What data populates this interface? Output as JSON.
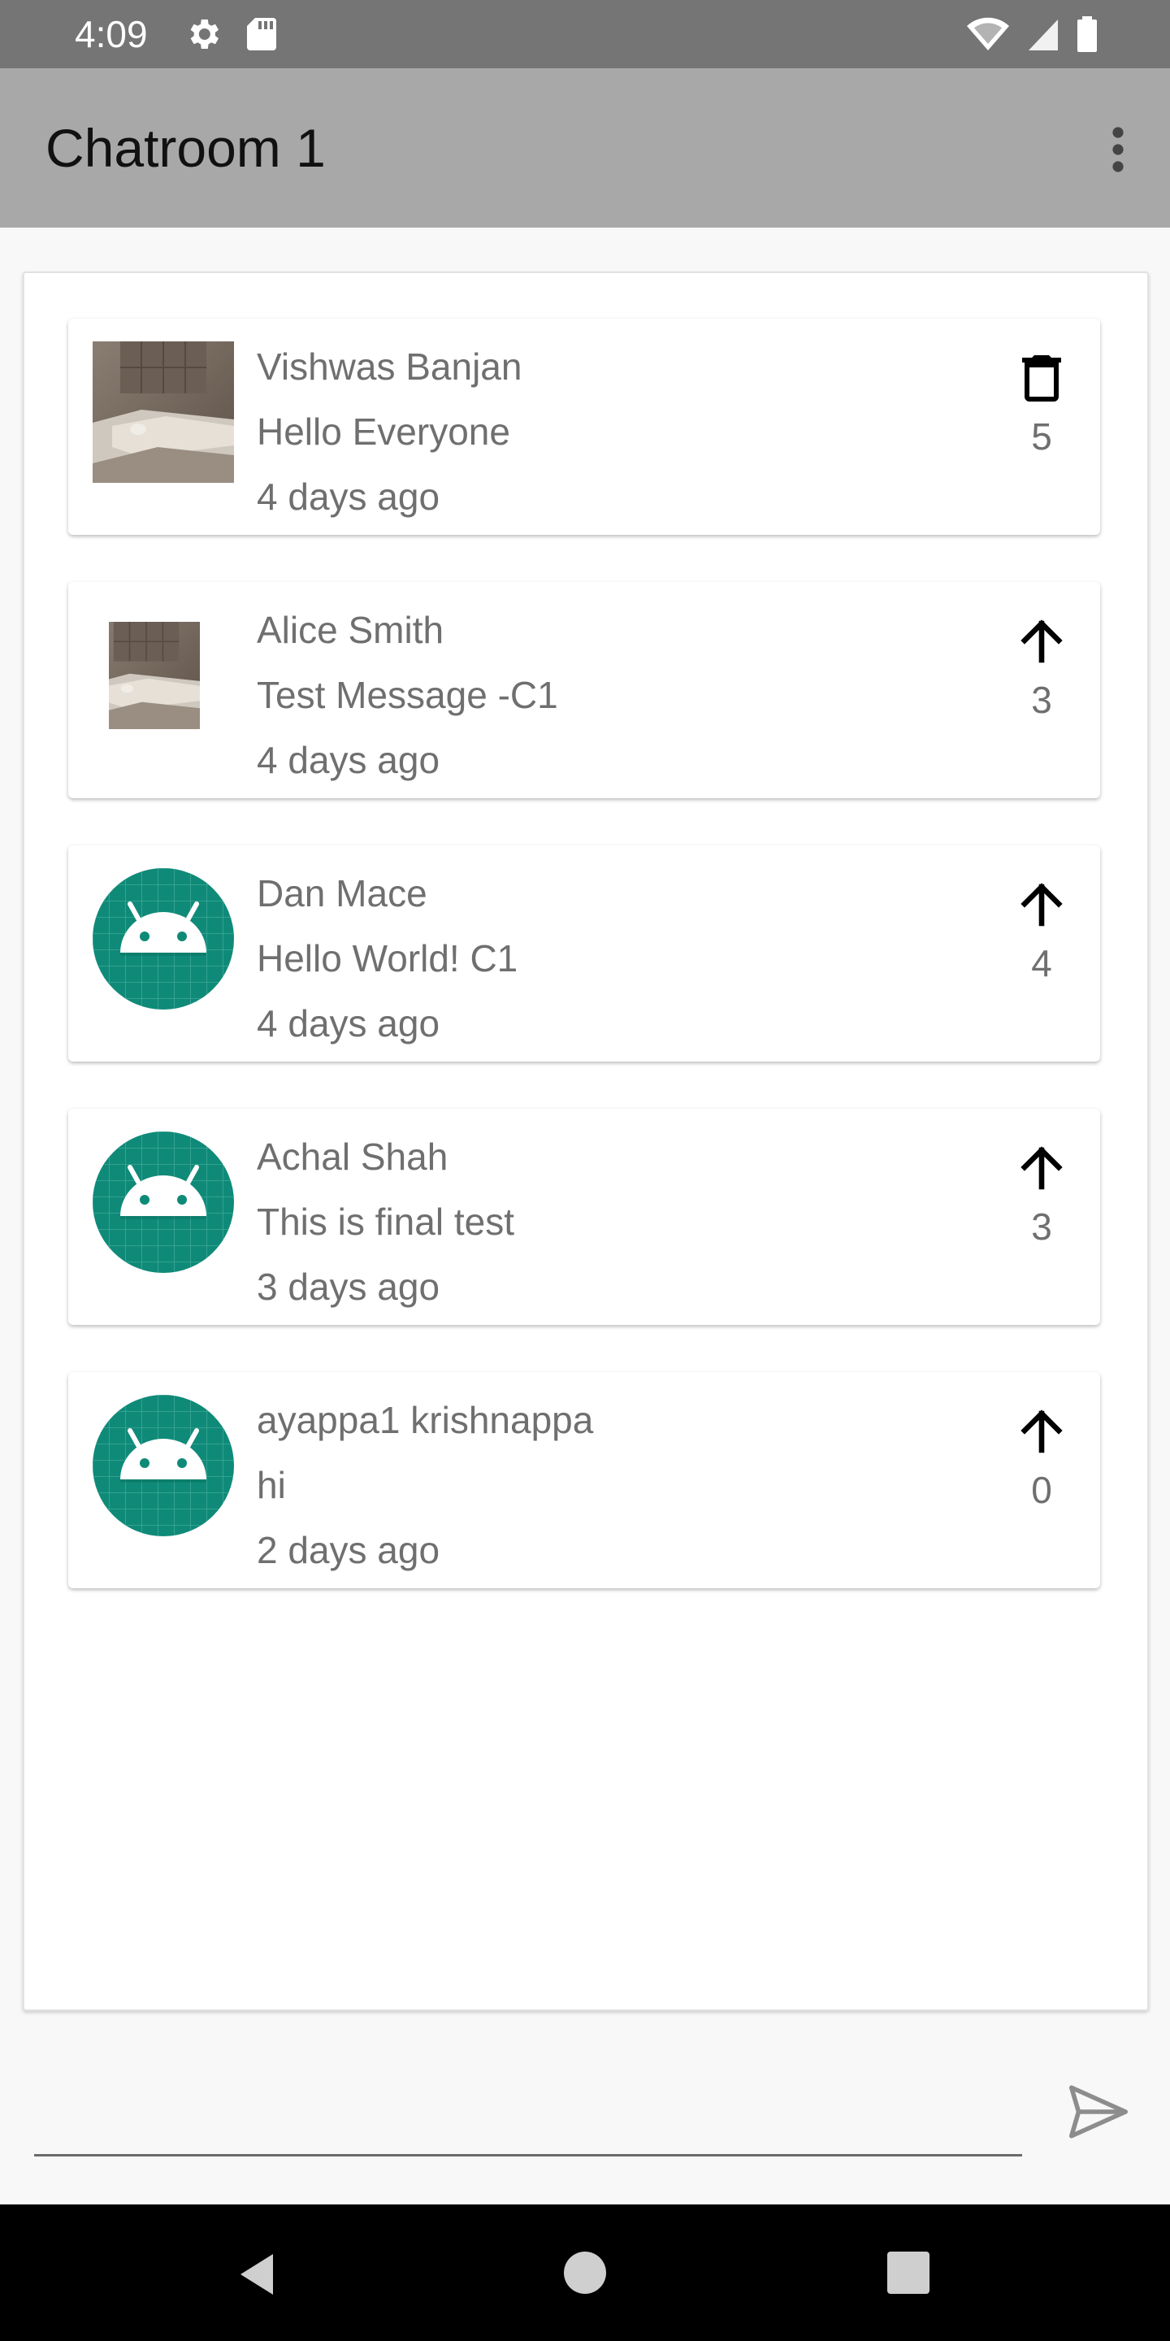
{
  "status_bar": {
    "time": "4:09",
    "left_icons": [
      "settings-icon",
      "sd-card-icon"
    ],
    "right_icons": [
      "wifi-icon",
      "cell-signal-icon",
      "battery-icon"
    ]
  },
  "app_bar": {
    "title": "Chatroom 1",
    "overflow_icon": "more-vert-icon"
  },
  "messages": [
    {
      "name": "Vishwas Banjan",
      "text": "Hello Everyone",
      "time": "4 days ago",
      "count": "5",
      "action_icon": "delete-icon",
      "avatar": "photo"
    },
    {
      "name": "Alice Smith",
      "text": "Test Message -C1",
      "time": "4 days ago",
      "count": "3",
      "action_icon": "arrow-up-icon",
      "avatar": "photo"
    },
    {
      "name": "Dan Mace",
      "text": "Hello World! C1",
      "time": "4 days ago",
      "count": "4",
      "action_icon": "arrow-up-icon",
      "avatar": "android"
    },
    {
      "name": "Achal Shah",
      "text": "This is final test",
      "time": "3 days ago",
      "count": "3",
      "action_icon": "arrow-up-icon",
      "avatar": "android"
    },
    {
      "name": "ayappa1 krishnappa",
      "text": "hi",
      "time": "2 days ago",
      "count": "0",
      "action_icon": "arrow-up-icon",
      "avatar": "android"
    }
  ],
  "composer": {
    "value": "",
    "placeholder": "",
    "send_icon": "send-icon"
  },
  "nav_bar": {
    "icons": [
      "back-icon",
      "home-icon",
      "recents-icon"
    ]
  },
  "colors": {
    "status_bar": "#757575",
    "app_bar": "#a8a8a8",
    "android_avatar": "#0f8a78"
  }
}
